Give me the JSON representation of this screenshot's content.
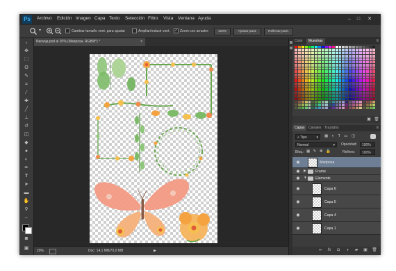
{
  "app": {
    "logo": "Ps"
  },
  "menu": [
    "Archivo",
    "Edición",
    "Imagen",
    "Capa",
    "Texto",
    "Selección",
    "Filtro",
    "Vista",
    "Ventana",
    "Ayuda"
  ],
  "window_controls": {
    "minimize": "–",
    "maximize": "□",
    "close": "✕"
  },
  "options": {
    "resize_windows_label": "Cambiar tamaño vent. para ajustar",
    "zoom_all_label": "Ampliar/reducir vent.",
    "scrubby_zoom_label": "Zoom con arrastre",
    "actual_pixels": "100%",
    "fit_screen": "Ajustar pant.",
    "fill_screen": "Rellenar pant."
  },
  "document": {
    "tab_title": "Naranja.psd al 20% (Mariposa, RGB/8*) *",
    "tab_close": "×"
  },
  "status": {
    "zoom": "20%",
    "doc_size": "Doc: 14,1 MB/70,0 MB",
    "arrow": "▶"
  },
  "top_panel": {
    "tabs": [
      "Color",
      "Muestras"
    ],
    "active_tab": "Muestras"
  },
  "layers_panel": {
    "tabs": [
      "Capas",
      "Canales",
      "Trazados"
    ],
    "active_tab": "Capas",
    "filter_kind": "Tipo",
    "blend_mode": "Normal",
    "opacity_label": "Opacidad:",
    "opacity_value": "100%",
    "lock_label": "Bloq.:",
    "fill_label": "Relleno:",
    "fill_value": "100%",
    "layers": [
      {
        "name": "Mariposa",
        "type": "layer",
        "selected": true
      },
      {
        "name": "Frame",
        "type": "group",
        "expanded": false
      },
      {
        "name": "Elements",
        "type": "group",
        "expanded": true
      },
      {
        "name": "Capa 6",
        "type": "layer",
        "indent": true
      },
      {
        "name": "Capa 5",
        "type": "layer",
        "indent": true
      },
      {
        "name": "Capa 4",
        "type": "layer",
        "indent": true
      },
      {
        "name": "Capa 1",
        "type": "layer",
        "indent": true
      }
    ]
  },
  "colors": {
    "accent_selected": "#6e7f95",
    "ps_blue": "#3fa9e6"
  }
}
